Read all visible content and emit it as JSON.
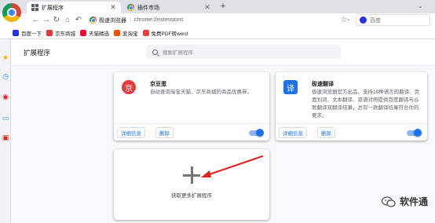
{
  "tabs": [
    {
      "title": "扩展程序",
      "active": true
    },
    {
      "title": "插件市场",
      "active": false
    }
  ],
  "toolbar": {
    "omnibox_name": "极速浏览器",
    "omnibox_separator": "|",
    "omnibox_url": "chrome://extensions",
    "search_engine": "百度"
  },
  "bookmarks": [
    {
      "label": "百度一下",
      "color": "#2932e1"
    },
    {
      "label": "京东商城",
      "color": "#e4393c"
    },
    {
      "label": "天猫精选",
      "color": "#ff0036"
    },
    {
      "label": "爱淘宝",
      "color": "#ff5000"
    },
    {
      "label": "免费PDF转word",
      "color": "#e64340"
    }
  ],
  "extensions_page": {
    "title": "扩展程序",
    "search_placeholder": "搜索扩展程序",
    "cards": [
      {
        "name": "京豆蛋",
        "logo_glyph": "京",
        "logo_color": "#e4393c",
        "description": "自动查询淘宝天猫、京东商城的商品优惠券。",
        "details_label": "详细信息",
        "remove_label": "删除",
        "enabled": true
      },
      {
        "name": "极速翻译",
        "logo_glyph": "译",
        "logo_color": "#1a73e8",
        "description": "极速浏览器官方出品。支持18种语言的翻译、页面划词、文本翻译、双语对照提供百度翻译与谷歌翻译双翻译结果，总有一款翻译结果符合你的要求。",
        "details_label": "详细信息",
        "remove_label": "删除",
        "enabled": true
      }
    ],
    "get_more_label": "获取更多扩展程序"
  },
  "watermark": {
    "text": "软件通"
  },
  "colors": {
    "accent": "#1a73e8",
    "arrow": "#e02020"
  }
}
